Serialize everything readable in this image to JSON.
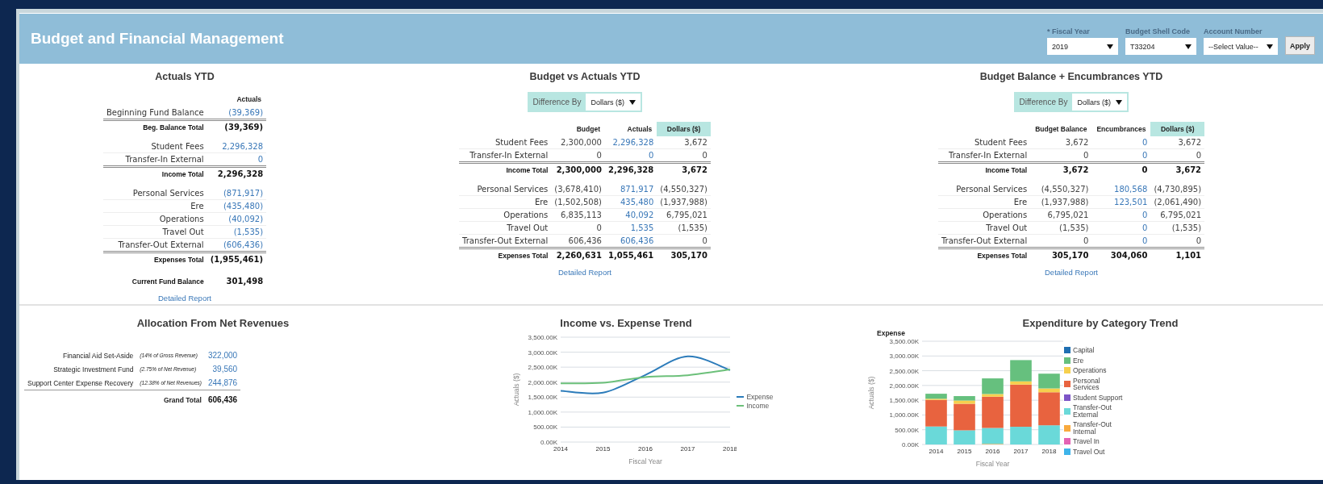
{
  "header": {
    "title": "Budget and Financial Management",
    "filters": [
      {
        "label": "* Fiscal Year",
        "value": "2019"
      },
      {
        "label": "Budget Shell Code",
        "value": "T33204"
      },
      {
        "label": "Account Number",
        "value": "--Select Value--"
      }
    ],
    "apply_button": "Apply"
  },
  "panels": [
    {
      "title": "Actuals YTD",
      "columns": [
        {
          "label": "Actuals",
          "kind": "link",
          "highlighted": false
        }
      ],
      "sections": [
        {
          "rows": [
            {
              "label": "Beginning Fund Balance",
              "values": [
                "(39,369)"
              ]
            }
          ],
          "total": {
            "label": "Beg. Balance Total",
            "values": [
              "(39,369)"
            ]
          }
        },
        {
          "rows": [
            {
              "label": "Student Fees",
              "values": [
                "2,296,328"
              ]
            },
            {
              "label": "Transfer-In External",
              "values": [
                "0"
              ]
            }
          ],
          "total": {
            "label": "Income Total",
            "values": [
              "2,296,328"
            ]
          }
        },
        {
          "rows": [
            {
              "label": "Personal Services",
              "values": [
                "(871,917)"
              ]
            },
            {
              "label": "Ere",
              "values": [
                "(435,480)"
              ]
            },
            {
              "label": "Operations",
              "values": [
                "(40,092)"
              ]
            },
            {
              "label": "Travel Out",
              "values": [
                "(1,535)"
              ]
            },
            {
              "label": "Transfer-Out External",
              "values": [
                "(606,436)"
              ]
            }
          ],
          "total": {
            "label": "Expenses Total",
            "values": [
              "(1,955,461)"
            ]
          }
        }
      ],
      "summary": {
        "label": "Current Fund Balance",
        "values": [
          "301,498"
        ]
      },
      "link": "Detailed Report"
    },
    {
      "title": "Budget vs Actuals YTD",
      "difference_by": {
        "label": "Difference By",
        "value": "Dollars ($)"
      },
      "columns": [
        {
          "label": "Budget",
          "kind": "plain",
          "highlighted": false
        },
        {
          "label": "Actuals",
          "kind": "link",
          "highlighted": false
        },
        {
          "label": "Dollars ($)",
          "kind": "plain",
          "highlighted": true
        }
      ],
      "sections": [
        {
          "rows": [
            {
              "label": "Student Fees",
              "values": [
                "2,300,000",
                "2,296,328",
                "3,672"
              ]
            },
            {
              "label": "Transfer-In External",
              "values": [
                "0",
                "0",
                "0"
              ]
            }
          ],
          "total": {
            "label": "Income Total",
            "values": [
              "2,300,000",
              "2,296,328",
              "3,672"
            ]
          }
        },
        {
          "rows": [
            {
              "label": "Personal Services",
              "values": [
                "(3,678,410)",
                "871,917",
                "(4,550,327)"
              ]
            },
            {
              "label": "Ere",
              "values": [
                "(1,502,508)",
                "435,480",
                "(1,937,988)"
              ]
            },
            {
              "label": "Operations",
              "values": [
                "6,835,113",
                "40,092",
                "6,795,021"
              ]
            },
            {
              "label": "Travel Out",
              "values": [
                "0",
                "1,535",
                "(1,535)"
              ]
            },
            {
              "label": "Transfer-Out External",
              "values": [
                "606,436",
                "606,436",
                "0"
              ]
            }
          ],
          "total": {
            "label": "Expenses Total",
            "values": [
              "2,260,631",
              "1,055,461",
              "305,170"
            ]
          }
        }
      ],
      "link": "Detailed Report"
    },
    {
      "title": "Budget Balance + Encumbrances YTD",
      "difference_by": {
        "label": "Difference By",
        "value": "Dollars ($)"
      },
      "columns": [
        {
          "label": "Budget Balance",
          "kind": "plain",
          "highlighted": false
        },
        {
          "label": "Encumbrances",
          "kind": "link",
          "highlighted": false
        },
        {
          "label": "Dollars ($)",
          "kind": "plain",
          "highlighted": true
        }
      ],
      "sections": [
        {
          "rows": [
            {
              "label": "Student Fees",
              "values": [
                "3,672",
                "0",
                "3,672"
              ]
            },
            {
              "label": "Transfer-In External",
              "values": [
                "0",
                "0",
                "0"
              ]
            }
          ],
          "total": {
            "label": "Income Total",
            "values": [
              "3,672",
              "0",
              "3,672"
            ]
          }
        },
        {
          "rows": [
            {
              "label": "Personal Services",
              "values": [
                "(4,550,327)",
                "180,568",
                "(4,730,895)"
              ]
            },
            {
              "label": "Ere",
              "values": [
                "(1,937,988)",
                "123,501",
                "(2,061,490)"
              ]
            },
            {
              "label": "Operations",
              "values": [
                "6,795,021",
                "0",
                "6,795,021"
              ]
            },
            {
              "label": "Travel Out",
              "values": [
                "(1,535)",
                "0",
                "(1,535)"
              ]
            },
            {
              "label": "Transfer-Out External",
              "values": [
                "0",
                "0",
                "0"
              ]
            }
          ],
          "total": {
            "label": "Expenses Total",
            "values": [
              "305,170",
              "304,060",
              "1,101"
            ]
          }
        }
      ],
      "link": "Detailed Report"
    }
  ],
  "allocation": {
    "title": "Allocation From Net Revenues",
    "rows": [
      {
        "label": "Financial Aid Set-Aside",
        "note": "(14% of Gross Revenue)",
        "value": "322,000"
      },
      {
        "label": "Strategic Investment Fund",
        "note": "(2.75% of Net Revenue)",
        "value": "39,560"
      },
      {
        "label": "Support Center Expense Recovery",
        "note": "(12.38% of Net Revenues)",
        "value": "244,876"
      }
    ],
    "total": {
      "label": "Grand Total",
      "value": "606,436"
    }
  },
  "income_trend": {
    "title": "Income vs. Expense Trend",
    "chart_data": {
      "type": "line",
      "xlabel": "Fiscal Year",
      "ylabel": "Actuals ($)",
      "x": [
        2014,
        2015,
        2016,
        2017,
        2018
      ],
      "series": [
        {
          "name": "Expense",
          "color": "#2b7bba",
          "values": [
            1710000,
            1650000,
            2240000,
            2860000,
            2400000
          ]
        },
        {
          "name": "Income",
          "color": "#6cc07a",
          "values": [
            1960000,
            1980000,
            2170000,
            2230000,
            2420000
          ]
        }
      ],
      "xlim": [
        2014,
        2018
      ],
      "grid": true,
      "ylim": [
        0,
        3500000
      ],
      "xticks": [
        2014,
        2015,
        2016,
        2017,
        2018
      ],
      "yticks": [
        {
          "value": 0,
          "label": "0.00K"
        },
        {
          "value": 500000,
          "label": "500.00K"
        },
        {
          "value": 1000000,
          "label": "1,000.00K"
        },
        {
          "value": 1500000,
          "label": "1,500.00K"
        },
        {
          "value": 2000000,
          "label": "2,000.00K"
        },
        {
          "value": 2500000,
          "label": "2,500.00K"
        },
        {
          "value": 3000000,
          "label": "3,000.00K"
        },
        {
          "value": 3500000,
          "label": "3,500.00K"
        }
      ]
    }
  },
  "expenditure_trend": {
    "title": "Expenditure by Category Trend",
    "legend_title": "Expense",
    "chart_data": {
      "type": "bar",
      "stacked": true,
      "xlabel": "Fiscal Year",
      "ylabel": "Actuals ($)",
      "categories": [
        "2014",
        "2015",
        "2016",
        "2017",
        "2018"
      ],
      "series": [
        {
          "name": "Travel Out",
          "color": "#3eb4ea",
          "values": [
            0,
            0,
            0,
            0,
            0
          ]
        },
        {
          "name": "Travel In",
          "color": "#e462b4",
          "values": [
            0,
            0,
            0,
            0,
            0
          ]
        },
        {
          "name": "Transfer-Out Internal",
          "color": "#f9aa3d",
          "values": [
            0,
            0,
            20000,
            0,
            0
          ]
        },
        {
          "name": "Transfer-Out External",
          "color": "#6ad9d9",
          "values": [
            610000,
            480000,
            540000,
            600000,
            650000
          ]
        },
        {
          "name": "Student Support",
          "color": "#7d55c7",
          "values": [
            0,
            0,
            0,
            0,
            0
          ]
        },
        {
          "name": "Personal Services",
          "color": "#e8633f",
          "values": [
            900000,
            900000,
            1060000,
            1430000,
            1120000
          ]
        },
        {
          "name": "Operations",
          "color": "#f6d04d",
          "values": [
            40000,
            110000,
            90000,
            110000,
            130000
          ]
        },
        {
          "name": "Ere",
          "color": "#66c07e",
          "values": [
            170000,
            150000,
            530000,
            720000,
            500000
          ]
        },
        {
          "name": "Capital",
          "color": "#1f6fb2",
          "values": [
            0,
            0,
            0,
            0,
            0
          ]
        }
      ],
      "grid": true,
      "ylim": [
        0,
        3500000
      ],
      "yticks": [
        {
          "value": 0,
          "label": "0.00K"
        },
        {
          "value": 500000,
          "label": "500.00K"
        },
        {
          "value": 1000000,
          "label": "1,000.00K"
        },
        {
          "value": 1500000,
          "label": "1,500.00K"
        },
        {
          "value": 2000000,
          "label": "2,000.00K"
        },
        {
          "value": 2500000,
          "label": "2,500.00K"
        },
        {
          "value": 3000000,
          "label": "3,000.00K"
        },
        {
          "value": 3500000,
          "label": "3,500.00K"
        }
      ]
    }
  }
}
